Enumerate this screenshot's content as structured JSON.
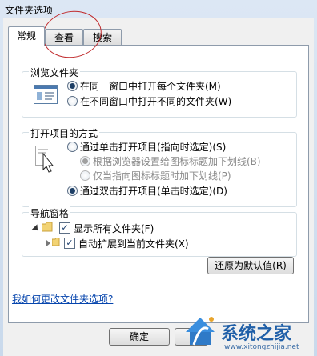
{
  "window": {
    "title": "文件夹选项"
  },
  "tabs": [
    {
      "label": "常规"
    },
    {
      "label": "查看"
    },
    {
      "label": "搜索"
    }
  ],
  "browse": {
    "legend": "浏览文件夹",
    "options": [
      {
        "label": "在同一窗口中打开每个文件夹(M)",
        "checked": true
      },
      {
        "label": "在不同窗口中打开不同的文件夹(W)",
        "checked": false
      }
    ]
  },
  "click": {
    "legend": "打开项目的方式",
    "options": [
      {
        "label": "通过单击打开项目(指向时选定)(S)",
        "checked": false
      },
      {
        "label": "根据浏览器设置给图标标题加下划线(B)",
        "checked": true,
        "disabled": true
      },
      {
        "label": "仅当指向图标标题时加下划线(P)",
        "checked": false,
        "disabled": true
      },
      {
        "label": "通过双击打开项目(单击时选定)(D)",
        "checked": true
      }
    ]
  },
  "nav": {
    "legend": "导航窗格",
    "items": [
      {
        "label": "显示所有文件夹(F)",
        "checked": true
      },
      {
        "label": "自动扩展到当前文件夹(X)",
        "checked": true
      }
    ]
  },
  "restore_label": "还原为默认值(R)",
  "help_link": "我如何更改文件夹选项?",
  "ok_label": "确定",
  "watermark": {
    "name": "系统之家",
    "url": "www.xitongzhijia.net"
  },
  "colors": {
    "accent": "#1e3f66",
    "link": "#0645ad",
    "annotation": "#c0292b"
  }
}
